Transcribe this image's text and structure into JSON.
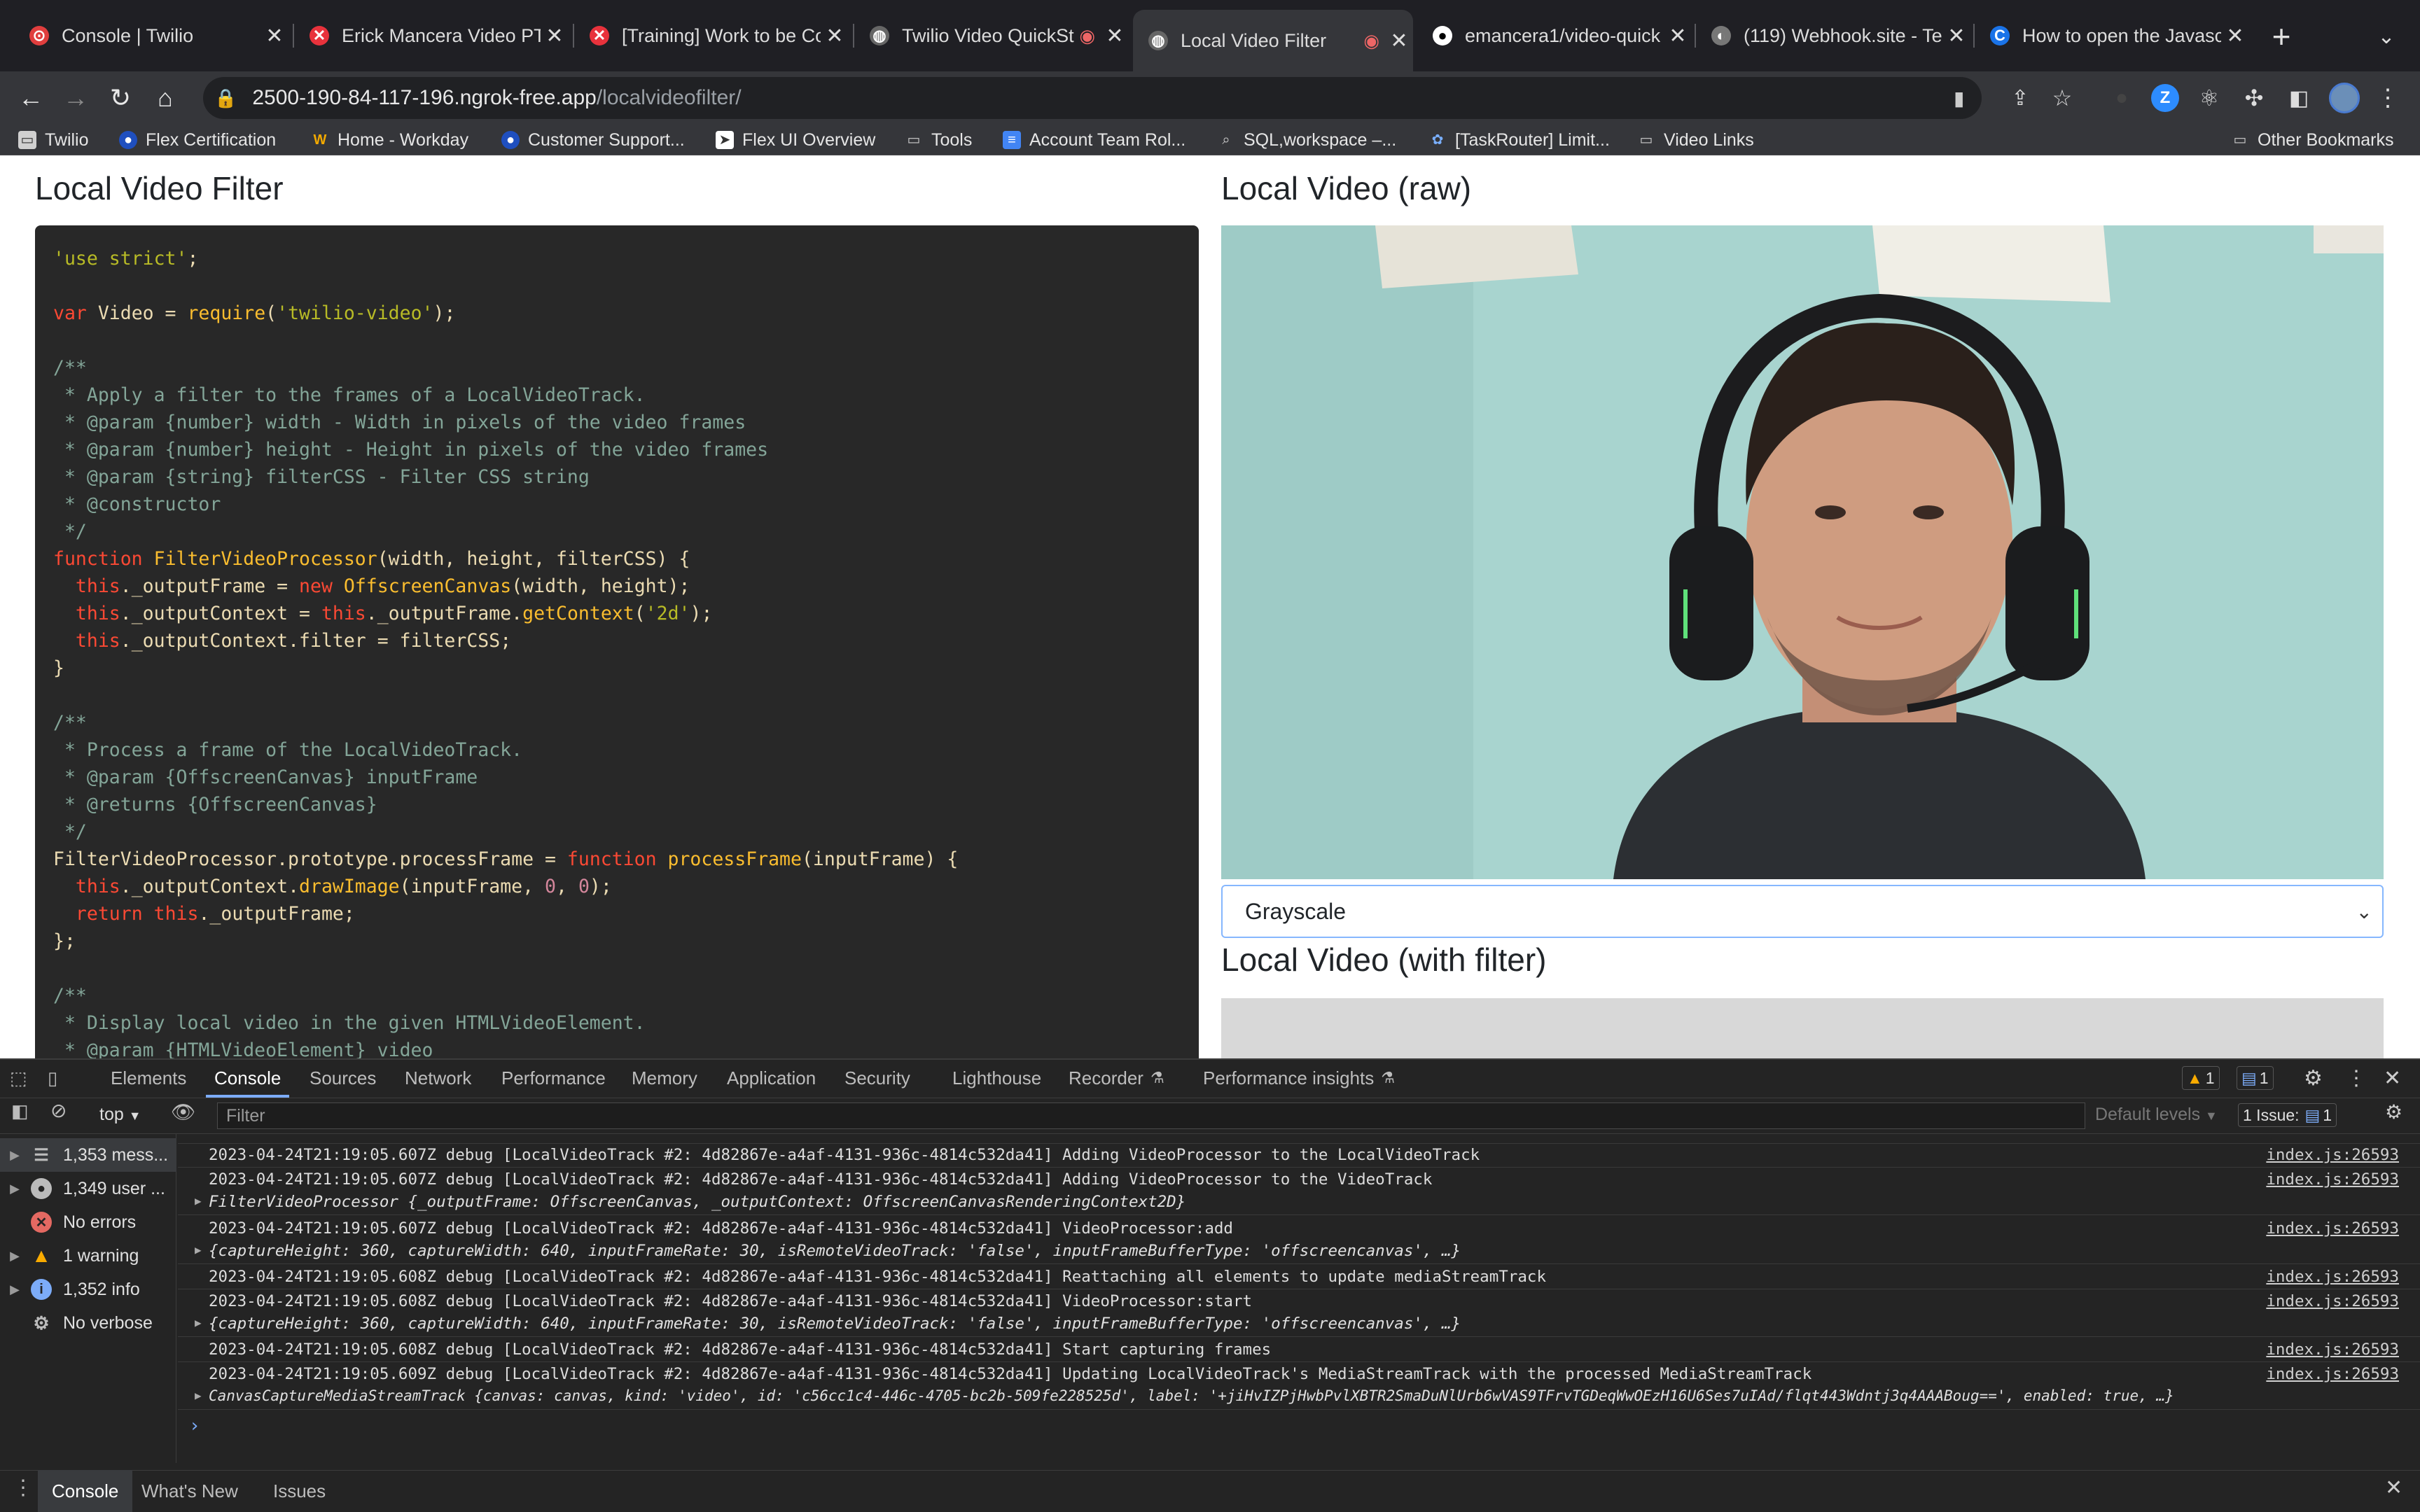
{
  "browser": {
    "tabs": [
      {
        "title": "Console | Twilio",
        "icon_color": "#e03e3e"
      },
      {
        "title": "Erick Mancera Video PT/",
        "icon_color": "#e8323c"
      },
      {
        "title": "[Training] Work to be Co",
        "icon_color": "#e8323c"
      },
      {
        "title": "Twilio Video QuickSt",
        "icon_color": "#777"
      },
      {
        "title": "Local Video Filter",
        "icon_color": "#777"
      },
      {
        "title": "emancera1/video-quick",
        "icon_color": "#333"
      },
      {
        "title": "(119) Webhook.site - Te",
        "icon_color": "#777"
      },
      {
        "title": "How to open the Javasc",
        "icon_color": "#1a73e8"
      }
    ],
    "new_tab": "+",
    "url_host": "2500-190-84-117-196.ngrok-free.app",
    "url_path": "/localvideofilter/",
    "bookmarks": [
      "Twilio",
      "Flex Certification",
      "Home - Workday",
      "Customer Support...",
      "Flex UI Overview",
      "Tools",
      "Account Team Rol...",
      "SQL,workspace –...",
      "[TaskRouter] Limit...",
      "Video Links"
    ],
    "other_bookmarks": "Other Bookmarks"
  },
  "page": {
    "left_title": "Local Video Filter",
    "raw_title": "Local Video (raw)",
    "filter_title": "Local Video (with filter)",
    "select_value": "Grayscale"
  },
  "devtools": {
    "tabs": [
      "Elements",
      "Console",
      "Sources",
      "Network",
      "Performance",
      "Memory",
      "Application",
      "Security",
      "Lighthouse",
      "Recorder",
      "Performance insights"
    ],
    "warn_badge": "1",
    "info_badge": "1",
    "context": "top",
    "filter_placeholder": "Filter",
    "levels": "Default levels",
    "issues": "1 Issue:",
    "issues_count": "1",
    "sidebar": [
      {
        "label": "1,353 mess...",
        "icon": "list-icon"
      },
      {
        "label": "1,349 user ...",
        "icon": "user-icon"
      },
      {
        "label": "No errors",
        "icon": "error-icon"
      },
      {
        "label": "1 warning",
        "icon": "warning-icon"
      },
      {
        "label": "1,352 info",
        "icon": "info-icon"
      },
      {
        "label": "No verbose",
        "icon": "gear-icon"
      }
    ],
    "logs": [
      {
        "msg": "2023-04-24T21:19:05.607Z debug [LocalVideoTrack #2: 4d82867e-a4af-4131-936c-4814c532da41] Adding VideoProcessor to the LocalVideoTrack",
        "src": "index.js:26593"
      },
      {
        "msg": "2023-04-24T21:19:05.607Z debug [LocalVideoTrack #2: 4d82867e-a4af-4131-936c-4814c532da41] Adding VideoProcessor to the VideoTrack",
        "src": "index.js:26593",
        "obj": "FilterVideoProcessor {_outputFrame: OffscreenCanvas, _outputContext: OffscreenCanvasRenderingContext2D}"
      },
      {
        "msg": "2023-04-24T21:19:05.607Z debug [LocalVideoTrack #2: 4d82867e-a4af-4131-936c-4814c532da41] VideoProcessor:add",
        "src": "index.js:26593",
        "obj": "{captureHeight: 360, captureWidth: 640, inputFrameRate: 30, isRemoteVideoTrack: 'false', inputFrameBufferType: 'offscreencanvas', …}"
      },
      {
        "msg": "2023-04-24T21:19:05.608Z debug [LocalVideoTrack #2: 4d82867e-a4af-4131-936c-4814c532da41] Reattaching all elements to update mediaStreamTrack",
        "src": "index.js:26593"
      },
      {
        "msg": "2023-04-24T21:19:05.608Z debug [LocalVideoTrack #2: 4d82867e-a4af-4131-936c-4814c532da41] VideoProcessor:start",
        "src": "index.js:26593",
        "obj": "{captureHeight: 360, captureWidth: 640, inputFrameRate: 30, isRemoteVideoTrack: 'false', inputFrameBufferType: 'offscreencanvas', …}"
      },
      {
        "msg": "2023-04-24T21:19:05.608Z debug [LocalVideoTrack #2: 4d82867e-a4af-4131-936c-4814c532da41] Start capturing frames",
        "src": "index.js:26593"
      },
      {
        "msg": "2023-04-24T21:19:05.609Z debug [LocalVideoTrack #2: 4d82867e-a4af-4131-936c-4814c532da41] Updating LocalVideoTrack's MediaStreamTrack with the processed MediaStreamTrack",
        "src": "index.js:26593",
        "obj": "CanvasCaptureMediaStreamTrack {canvas: canvas, kind: 'video', id: 'c56cc1c4-446c-4705-bc2b-509fe228525d', label: '+jiHvIZPjHwbPvlXBTR2SmaDuNlUrb6wVAS9TFrvTGDeqWwOEzH16U6Ses7uIAd/flqt443Wdntj3q4AAABoug==', enabled: true, …}"
      }
    ],
    "prompt": "›",
    "bottom_tabs": [
      "Console",
      "What's New",
      "Issues"
    ]
  }
}
